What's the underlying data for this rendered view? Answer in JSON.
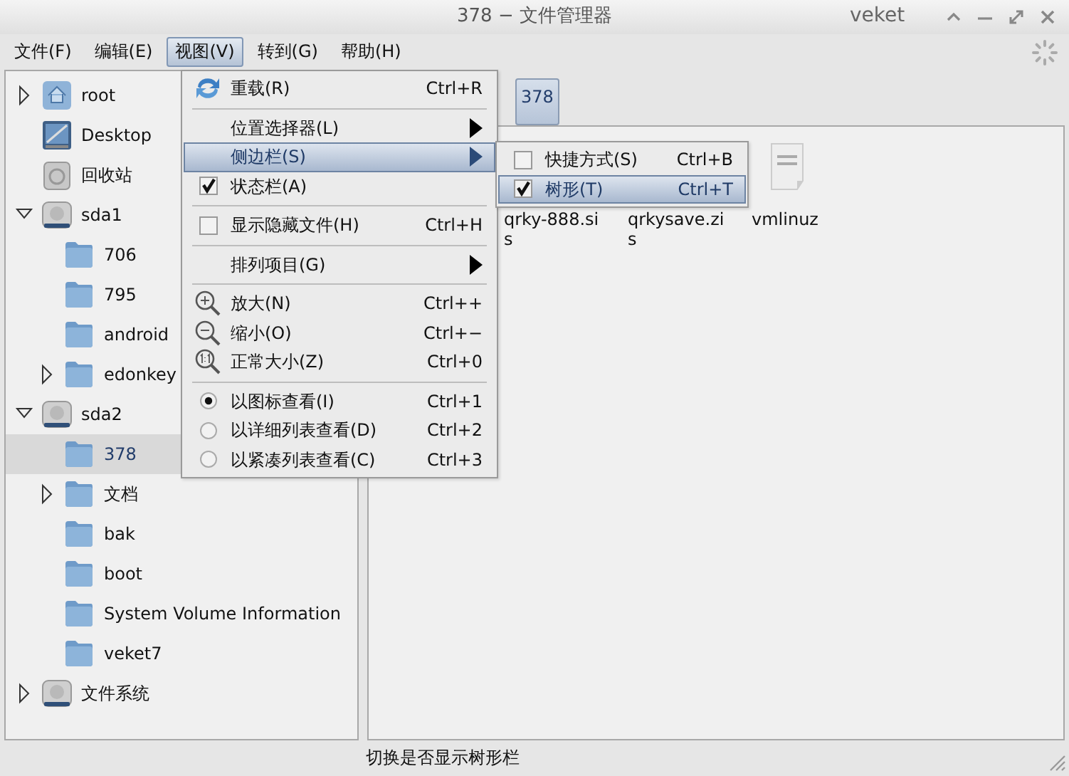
{
  "window": {
    "title": "378 − 文件管理器",
    "host": "veket"
  },
  "menubar": [
    {
      "label": "文件(F)",
      "selected": false
    },
    {
      "label": "编辑(E)",
      "selected": false
    },
    {
      "label": "视图(V)",
      "selected": true
    },
    {
      "label": "转到(G)",
      "selected": false
    },
    {
      "label": "帮助(H)",
      "selected": false
    }
  ],
  "view_menu": [
    {
      "kind": "command",
      "label": "重载(R)",
      "shortcut": "Ctrl+R",
      "selected": false
    },
    {
      "kind": "separator"
    },
    {
      "kind": "submenu",
      "label": "位置选择器(L)",
      "selected": false
    },
    {
      "kind": "submenu",
      "label": "侧边栏(S)",
      "selected": true
    },
    {
      "kind": "check",
      "label": "状态栏(A)",
      "checked": true,
      "selected": false
    },
    {
      "kind": "separator"
    },
    {
      "kind": "check",
      "label": "显示隐藏文件(H)",
      "shortcut": "Ctrl+H",
      "checked": false,
      "selected": false
    },
    {
      "kind": "separator"
    },
    {
      "kind": "submenu",
      "label": "排列项目(G)",
      "selected": false
    },
    {
      "kind": "separator"
    },
    {
      "kind": "command",
      "label": "放大(N)",
      "shortcut": "Ctrl++",
      "selected": false
    },
    {
      "kind": "command",
      "label": "缩小(O)",
      "shortcut": "Ctrl+−",
      "selected": false
    },
    {
      "kind": "command",
      "label": "正常大小(Z)",
      "shortcut": "Ctrl+0",
      "selected": false
    },
    {
      "kind": "separator"
    },
    {
      "kind": "radio",
      "label": "以图标查看(I)",
      "shortcut": "Ctrl+1",
      "checked": true,
      "selected": false
    },
    {
      "kind": "radio",
      "label": "以详细列表查看(D)",
      "shortcut": "Ctrl+2",
      "checked": false,
      "selected": false
    },
    {
      "kind": "radio",
      "label": "以紧凑列表查看(C)",
      "shortcut": "Ctrl+3",
      "checked": false,
      "selected": false
    }
  ],
  "sidebar_submenu": [
    {
      "kind": "check",
      "label": "快捷方式(S)",
      "shortcut": "Ctrl+B",
      "checked": false,
      "selected": false
    },
    {
      "kind": "check",
      "label": "树形(T)",
      "shortcut": "Ctrl+T",
      "checked": true,
      "selected": true
    }
  ],
  "tree": [
    {
      "label": "root",
      "kind": "home",
      "expanded": false,
      "selected": false
    },
    {
      "label": "Desktop",
      "kind": "desktop",
      "selected": false
    },
    {
      "label": "回收站",
      "kind": "trash",
      "selected": false
    },
    {
      "label": "sda1",
      "kind": "drive",
      "expanded": true,
      "selected": false,
      "children": [
        {
          "label": "706",
          "kind": "folder",
          "selected": false
        },
        {
          "label": "795",
          "kind": "folder",
          "selected": false
        },
        {
          "label": "android",
          "kind": "folder",
          "selected": false
        },
        {
          "label": "edonkey",
          "kind": "folder",
          "expanded": false,
          "selected": false
        }
      ]
    },
    {
      "label": "sda2",
      "kind": "drive",
      "expanded": true,
      "selected": false,
      "children": [
        {
          "label": "378",
          "kind": "folder",
          "selected": true
        },
        {
          "label": "文档",
          "kind": "folder",
          "expanded": false,
          "selected": false
        },
        {
          "label": "bak",
          "kind": "folder",
          "selected": false
        },
        {
          "label": "boot",
          "kind": "folder",
          "selected": false
        },
        {
          "label": "System Volume Information",
          "kind": "folder",
          "selected": false
        },
        {
          "label": "veket7",
          "kind": "folder",
          "selected": false
        }
      ]
    },
    {
      "label": "文件系统",
      "kind": "drive",
      "expanded": false,
      "selected": false
    }
  ],
  "path_buttons": [
    {
      "label": "378",
      "selected": true
    }
  ],
  "files": [
    {
      "lines": [
        "qrky-888.si",
        "s"
      ]
    },
    {
      "lines": [
        "qrkysave.zi",
        "s"
      ]
    },
    {
      "kind": "binary",
      "lines": [
        "vmlinuz"
      ]
    }
  ],
  "status_bar": "切换是否显示树形栏"
}
